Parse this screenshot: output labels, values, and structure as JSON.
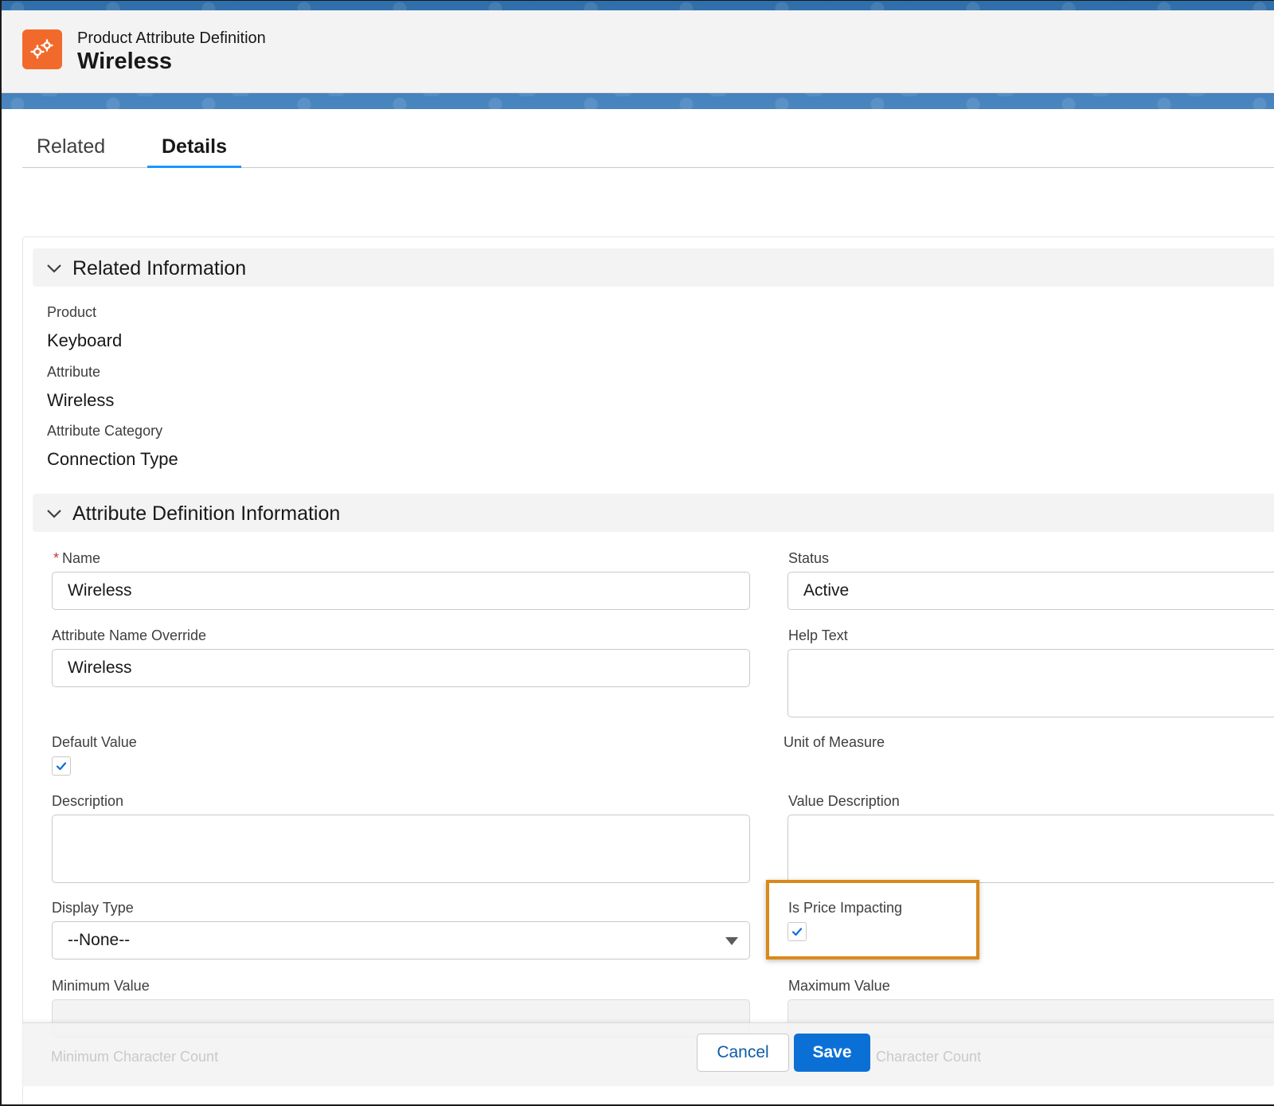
{
  "header": {
    "object_type": "Product Attribute Definition",
    "record_name": "Wireless",
    "icon": "gears-icon",
    "icon_color": "#f26a2b"
  },
  "tabs": [
    {
      "label": "Related",
      "active": false
    },
    {
      "label": "Details",
      "active": true
    }
  ],
  "related_information": {
    "title": "Related Information",
    "fields": [
      {
        "label": "Product",
        "value": "Keyboard"
      },
      {
        "label": "Attribute",
        "value": "Wireless"
      },
      {
        "label": "Attribute Category",
        "value": "Connection Type"
      }
    ]
  },
  "attribute_definition": {
    "title": "Attribute Definition Information",
    "name": {
      "label": "Name",
      "required_mark": "*",
      "value": "Wireless"
    },
    "status": {
      "label": "Status",
      "value": "Active"
    },
    "attribute_name_override": {
      "label": "Attribute Name Override",
      "value": "Wireless"
    },
    "help_text": {
      "label": "Help Text",
      "value": ""
    },
    "default_value": {
      "label": "Default Value",
      "checked": true
    },
    "unit_of_measure": {
      "label": "Unit of Measure"
    },
    "description": {
      "label": "Description",
      "value": ""
    },
    "value_description": {
      "label": "Value Description",
      "value": ""
    },
    "display_type": {
      "label": "Display Type",
      "value": "--None--"
    },
    "is_price_impacting": {
      "label": "Is Price Impacting",
      "checked": true
    },
    "minimum_value": {
      "label": "Minimum Value",
      "value": ""
    },
    "maximum_value": {
      "label": "Maximum Value",
      "value": ""
    },
    "minimum_character_count": {
      "label": "Minimum Character Count"
    },
    "maximum_character_count": {
      "label": "Character Count"
    }
  },
  "footer": {
    "cancel_label": "Cancel",
    "save_label": "Save"
  },
  "colors": {
    "brand": "#0b70d6",
    "tab_active": "#1b96ff",
    "highlight": "#d9891c",
    "required": "#c23934"
  }
}
